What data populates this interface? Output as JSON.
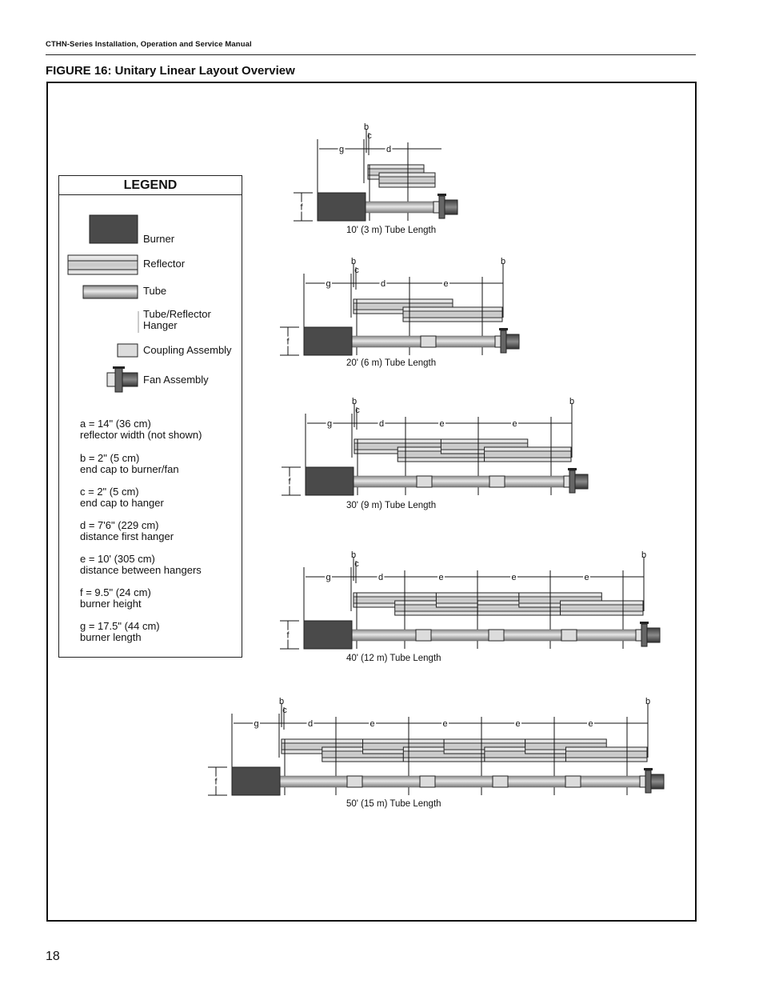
{
  "header": {
    "running_title": "CTHN-Series Installation, Operation and Service Manual"
  },
  "figure": {
    "title": "FIGURE 16: Unitary Linear Layout Overview"
  },
  "legend": {
    "title": "LEGEND",
    "items": [
      {
        "icon": "burner-icon",
        "label": "Burner"
      },
      {
        "icon": "reflector-icon",
        "label": "Reflector"
      },
      {
        "icon": "tube-icon",
        "label": "Tube"
      },
      {
        "icon": "hanger-icon",
        "label": "Tube/Reflector Hanger"
      },
      {
        "icon": "coupling-icon",
        "label": "Coupling Assembly"
      },
      {
        "icon": "fan-icon",
        "label": "Fan Assembly"
      }
    ],
    "definitions": [
      {
        "value": "a =  14\" (36 cm)",
        "desc": "reflector width (not shown)"
      },
      {
        "value": "b =  2\" (5 cm)",
        "desc": "end cap to burner/fan"
      },
      {
        "value": "c =  2\" (5 cm)",
        "desc": "end cap to hanger"
      },
      {
        "value": "d =  7'6\" (229 cm)",
        "desc": "distance first hanger"
      },
      {
        "value": "e =  10' (305 cm)",
        "desc": "distance between hangers"
      },
      {
        "value": "f  =  9.5\" (24 cm)",
        "desc": "burner height"
      },
      {
        "value": "g =  17.5\" (44 cm)",
        "desc": "burner length"
      }
    ]
  },
  "layouts": [
    {
      "caption": "10' (3 m) Tube Length",
      "e_segments": 0,
      "couplings": 0
    },
    {
      "caption": "20' (6 m) Tube Length",
      "e_segments": 1,
      "couplings": 1
    },
    {
      "caption": "30' (9 m) Tube Length",
      "e_segments": 2,
      "couplings": 2
    },
    {
      "caption": "40' (12 m) Tube Length",
      "e_segments": 3,
      "couplings": 3
    },
    {
      "caption": "50' (15 m) Tube Length",
      "e_segments": 4,
      "couplings": 4
    }
  ],
  "dimension_labels": {
    "b": "b",
    "c": "c",
    "d": "d",
    "e": "e",
    "f": "f",
    "g": "g"
  },
  "colors": {
    "burner": "#4a4a4a",
    "reflector": "#d4d4d4",
    "tube": "#b9b9b9",
    "coupling": "#dcdcdc",
    "fan": "#5a5a5a"
  },
  "page": {
    "number": "18"
  }
}
